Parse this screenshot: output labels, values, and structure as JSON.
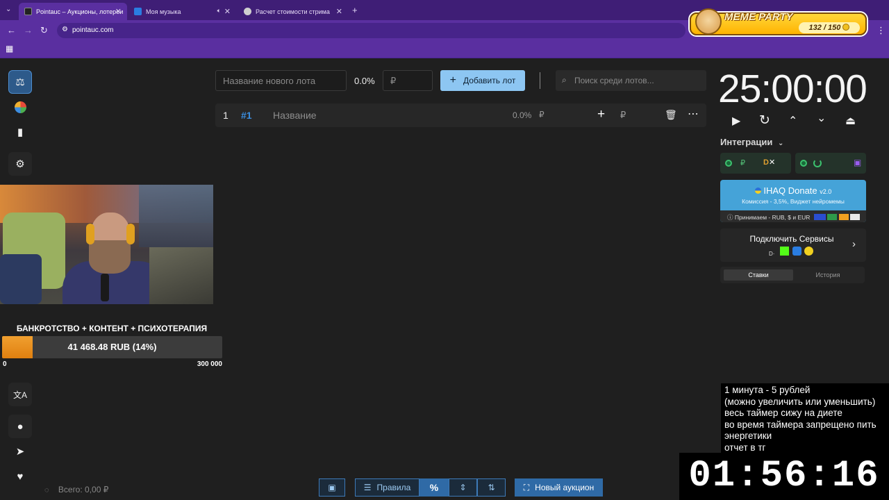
{
  "browser": {
    "tabs": [
      {
        "title": "Pointauc – Аукционы, лотереи",
        "active": true
      },
      {
        "title": "Моя музыка",
        "active": false
      },
      {
        "title": "Расчет стоимости стрима",
        "active": false
      }
    ],
    "url": "pointauc.com"
  },
  "meme_party": {
    "title": "MEME PARTY",
    "count": "132 / 150"
  },
  "toolbar": {
    "new_lot_placeholder": "Название нового лота",
    "percent": "0.0%",
    "amount_placeholder": "₽",
    "add_lot_label": "Добавить лот",
    "search_placeholder": "Поиск среди лотов..."
  },
  "lots": [
    {
      "index": "1",
      "id": "#1",
      "name": "Название",
      "percent": "0.0%",
      "currency": "₽"
    }
  ],
  "timer": {
    "value": "25:00:00"
  },
  "integrations": {
    "title": "Интеграции",
    "ruble": "₽",
    "dx_label": "D"
  },
  "ihaq": {
    "title": "IHAQ Donate",
    "version": "v2.0",
    "commission": "Комиссия - 3,5%, Виджет нейромемы",
    "accept": "Принимаем - RUB, $ и EUR"
  },
  "connect_services": {
    "label": "Подключить Сервисы"
  },
  "history_tabs": {
    "bets": "Ставки",
    "history": "История"
  },
  "stream_goal": {
    "title": "БАНКРОТСТВО + КОНТЕНТ + ПСИХОТЕРАПИЯ",
    "label": "41 468.48 RUB (14%)",
    "progress_percent": 14,
    "min": "0",
    "max": "300 000"
  },
  "footer": {
    "total": "Всего: 0,00 ₽",
    "rules_label": "Правила",
    "new_auction_label": "Новый аукцион"
  },
  "rules_overlay": {
    "lines": [
      "1 минута - 5 рублей",
      "(можно увеличить или уменьшить)",
      "весь таймер сижу на диете",
      "во время таймера запрещено пить",
      "энергетики",
      "отчет в тг"
    ]
  },
  "countdown": {
    "value": "01:56:16"
  },
  "colors": {
    "browser_dark": "#3f1e76",
    "browser": "#5a2fa0",
    "accent_blue": "#8dc6f2",
    "progress_orange": "#f0a030",
    "ihaq_blue": "#45a3d8"
  }
}
